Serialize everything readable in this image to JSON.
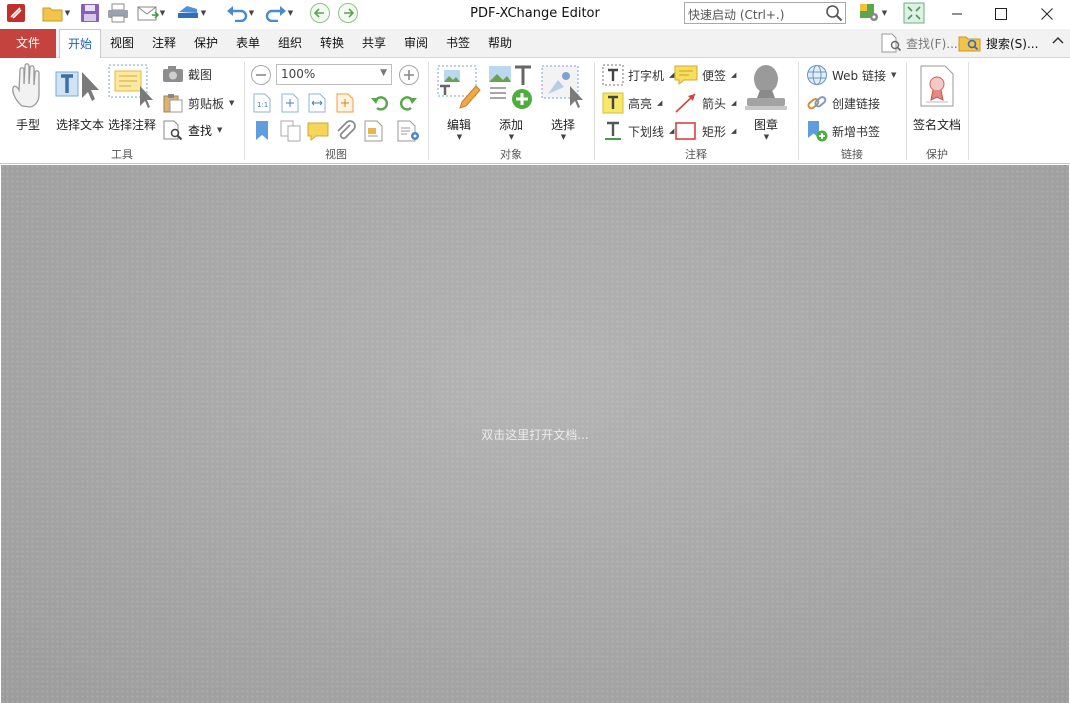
{
  "window": {
    "title": "PDF-XChange Editor",
    "quick_launch_placeholder": "快速启动 (Ctrl+.)"
  },
  "tabs": {
    "file": "文件",
    "items": [
      "开始",
      "视图",
      "注释",
      "保护",
      "表单",
      "组织",
      "转换",
      "共享",
      "审阅",
      "书签",
      "帮助"
    ],
    "active": "开始",
    "find_label": "查找(F)...",
    "search_label": "搜索(S)..."
  },
  "ribbon": {
    "tools": {
      "label": "工具",
      "hand": "手型",
      "select_text": "选择文本",
      "select_comment": "选择注释",
      "snapshot": "截图",
      "clipboard": "剪贴板",
      "find": "查找"
    },
    "view": {
      "label": "视图",
      "zoom_value": "100%"
    },
    "objects": {
      "label": "对象",
      "edit": "编辑",
      "add": "添加",
      "select": "选择"
    },
    "comments": {
      "label": "注释",
      "typewriter": "打字机",
      "highlight": "高亮",
      "underline": "下划线",
      "sticky_note": "便签",
      "arrow": "箭头",
      "rectangle": "矩形",
      "stamp": "图章"
    },
    "links": {
      "label": "链接",
      "web_links": "Web 链接",
      "create_link": "创建链接",
      "add_bookmark": "新增书签"
    },
    "protect": {
      "label": "保护",
      "sign_document": "签名文档"
    }
  },
  "workspace": {
    "hint": "双击这里打开文档..."
  },
  "colors": {
    "file_tab": "#c4433f",
    "active_tab_text": "#1f5fbf",
    "workspace": "#a6a6a6"
  }
}
